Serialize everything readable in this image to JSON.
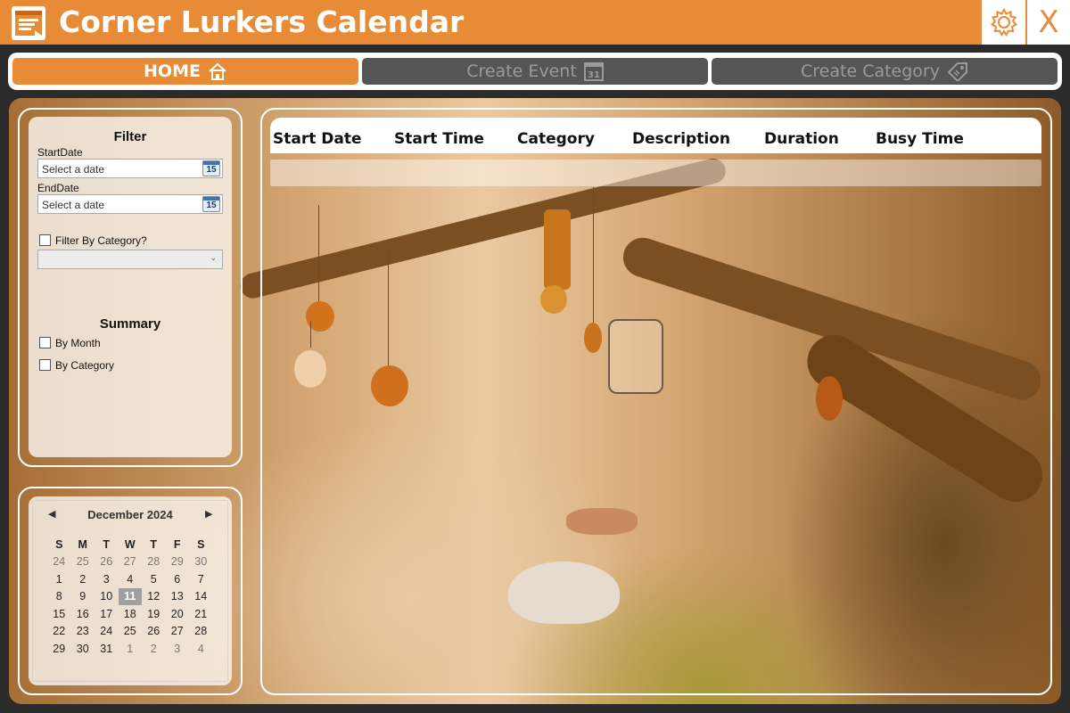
{
  "window": {
    "title": "Corner Lurkers Calendar",
    "close_label": "X"
  },
  "nav": {
    "tabs": [
      {
        "label": "HOME",
        "icon": "house-icon",
        "active": true
      },
      {
        "label": "Create Event",
        "icon": "calendar-31-icon",
        "active": false
      },
      {
        "label": "Create Category",
        "icon": "tag-icon",
        "active": false
      }
    ]
  },
  "colors": {
    "accent": "#e88b36",
    "inactive_tab": "#555555",
    "inactive_text": "#9b9b9b"
  },
  "filter": {
    "heading": "Filter",
    "start_label": "StartDate",
    "start_placeholder": "Select a date",
    "end_label": "EndDate",
    "end_placeholder": "Select a date",
    "calendar_button_day": "15",
    "category_checkbox_label": "Filter By Category?",
    "category_value": ""
  },
  "summary": {
    "heading": "Summary",
    "by_month_label": "By Month",
    "by_category_label": "By Category"
  },
  "calendar": {
    "month_label": "December 2024",
    "weekdays": [
      "S",
      "M",
      "T",
      "W",
      "T",
      "F",
      "S"
    ],
    "weeks": [
      [
        "24",
        "25",
        "26",
        "27",
        "28",
        "29",
        "30"
      ],
      [
        "1",
        "2",
        "3",
        "4",
        "5",
        "6",
        "7"
      ],
      [
        "8",
        "9",
        "10",
        "11",
        "12",
        "13",
        "14"
      ],
      [
        "15",
        "16",
        "17",
        "18",
        "19",
        "20",
        "21"
      ],
      [
        "22",
        "23",
        "24",
        "25",
        "26",
        "27",
        "28"
      ],
      [
        "29",
        "30",
        "31",
        "1",
        "2",
        "3",
        "4"
      ]
    ],
    "selected_day": "11"
  },
  "events_table": {
    "columns": [
      "Start Date",
      "Start Time",
      "Category",
      "Description",
      "Duration",
      "Busy Time"
    ],
    "rows": []
  }
}
